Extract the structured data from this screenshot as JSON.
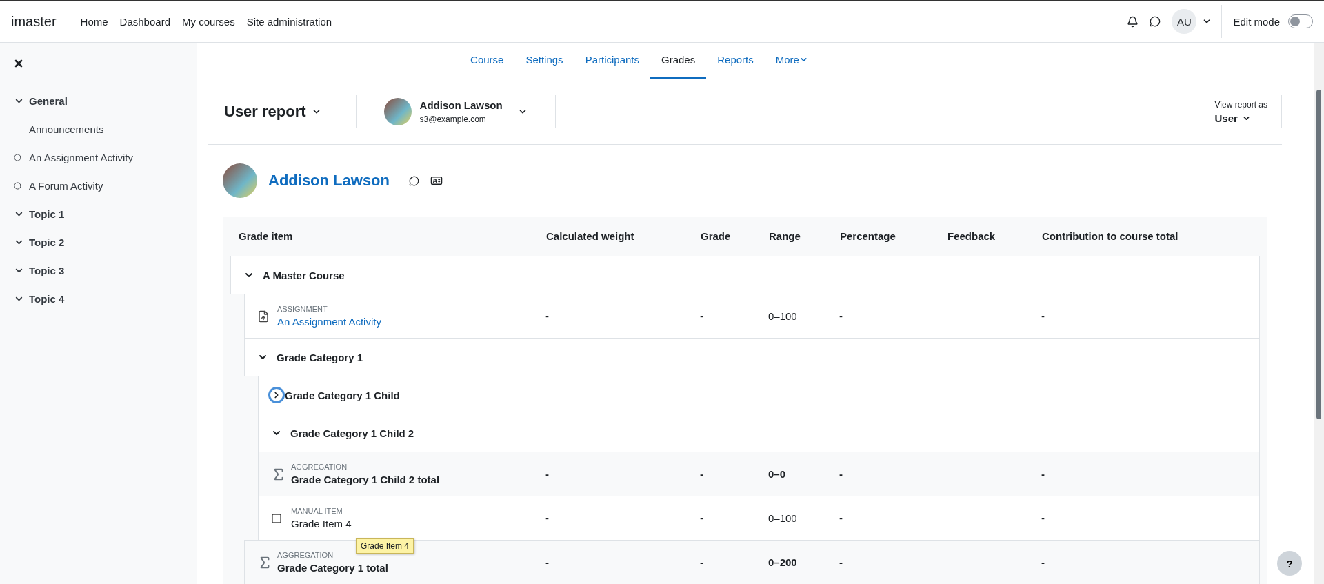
{
  "topbar": {
    "brand": "imaster",
    "nav": [
      {
        "label": "Home"
      },
      {
        "label": "Dashboard"
      },
      {
        "label": "My courses"
      },
      {
        "label": "Site administration"
      }
    ],
    "avatar_initials": "AU",
    "edit_mode": {
      "label": "Edit mode",
      "on": false
    }
  },
  "sidebar": {
    "items": [
      {
        "kind": "section",
        "label": "General",
        "expanded": true
      },
      {
        "kind": "page",
        "label": "Announcements"
      },
      {
        "kind": "activity",
        "label": "An Assignment Activity"
      },
      {
        "kind": "activity",
        "label": "A Forum Activity"
      },
      {
        "kind": "section",
        "label": "Topic 1",
        "expanded": true
      },
      {
        "kind": "section",
        "label": "Topic 2",
        "expanded": true
      },
      {
        "kind": "section",
        "label": "Topic 3",
        "expanded": true
      },
      {
        "kind": "section",
        "label": "Topic 4",
        "expanded": true
      }
    ]
  },
  "course_tabs": [
    {
      "label": "Course",
      "selected": false
    },
    {
      "label": "Settings",
      "selected": false
    },
    {
      "label": "Participants",
      "selected": false
    },
    {
      "label": "Grades",
      "selected": true
    },
    {
      "label": "Reports",
      "selected": false
    },
    {
      "label": "More",
      "selected": false,
      "dropdown": true
    }
  ],
  "report_header": {
    "report": "User report",
    "user_name": "Addison Lawson",
    "user_email": "s3@example.com",
    "view_as_label": "View report as",
    "view_as": "User"
  },
  "user_heading": {
    "name": "Addison Lawson"
  },
  "table": {
    "columns": [
      "Grade item",
      "Calculated weight",
      "Grade",
      "Range",
      "Percentage",
      "Feedback",
      "Contribution to course total"
    ],
    "rows": [
      {
        "kind": "category",
        "name": "A Master Course",
        "expanded": true,
        "focused": false,
        "children": [
          {
            "kind": "assignment",
            "type_label": "ASSIGNMENT",
            "name": "An Assignment Activity",
            "calculated_weight": "-",
            "grade": "-",
            "range": "0–100",
            "percentage": "-",
            "contribution": "-"
          },
          {
            "kind": "category",
            "name": "Grade Category 1",
            "expanded": true,
            "focused": false,
            "children": [
              {
                "kind": "category",
                "name": "Grade Category 1 Child",
                "expanded": false,
                "focused": true
              },
              {
                "kind": "category",
                "name": "Grade Category 1 Child 2",
                "expanded": true,
                "focused": false,
                "total": {
                  "kind": "aggregation",
                  "type_label": "AGGREGATION",
                  "name": "Grade Category 1 Child 2 total",
                  "calculated_weight": "-",
                  "grade": "-",
                  "range": "0–0",
                  "percentage": "-",
                  "contribution": "-"
                }
              },
              {
                "kind": "manual",
                "type_label": "MANUAL ITEM",
                "name": "Grade Item 4",
                "calculated_weight": "-",
                "grade": "-",
                "range": "0–100",
                "percentage": "-",
                "contribution": "-",
                "tooltip": "Grade Item 4"
              }
            ],
            "total": {
              "kind": "aggregation",
              "type_label": "AGGREGATION",
              "name": "Grade Category 1 total",
              "calculated_weight": "-",
              "grade": "-",
              "range": "0–200",
              "percentage": "-",
              "contribution": "-"
            }
          }
        ]
      }
    ]
  },
  "help_button": "?"
}
